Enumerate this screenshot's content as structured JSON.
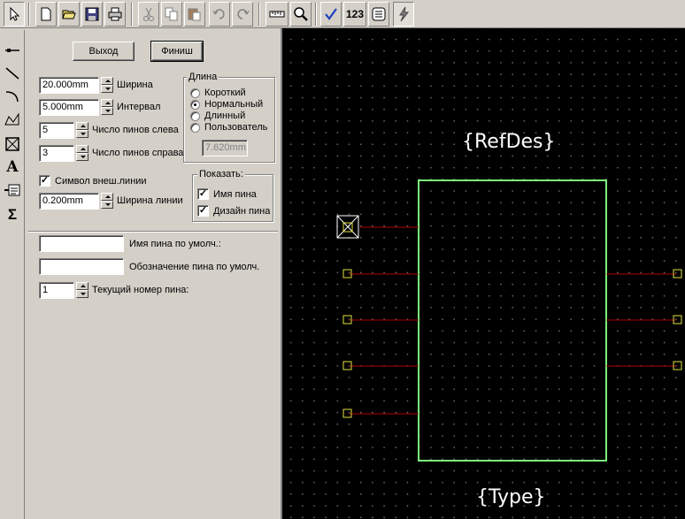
{
  "toolbar": {
    "icons": [
      "select-arrow-icon",
      "new-file-icon",
      "open-folder-icon",
      "save-icon",
      "print-icon",
      "cut-icon",
      "copy-icon",
      "paste-icon",
      "undo-icon",
      "redo-icon",
      "ruler-icon",
      "zoom-icon",
      "checkmark-icon",
      "number-icon",
      "properties-icon",
      "lightning-icon"
    ],
    "number_label": "123"
  },
  "left_tools": {
    "icons": [
      "pin-tool-icon",
      "line-tool-icon",
      "arc-tool-icon",
      "polyline-tool-icon",
      "box-cross-tool-icon",
      "text-tool-icon",
      "attribute-tool-icon",
      "sigma-tool-icon"
    ],
    "text_tool_label": "A",
    "sigma_label": "Σ"
  },
  "buttons": {
    "exit": "Выход",
    "finish": "Финиш"
  },
  "params": {
    "width_value": "20.000mm",
    "width_label": "Ширина",
    "interval_value": "5.000mm",
    "interval_label": "Интервал",
    "pins_left_value": "5",
    "pins_left_label": "Число пинов слева",
    "pins_right_value": "3",
    "pins_right_label": "Число пинов справа",
    "outline_label": "Символ внеш.линии",
    "line_width_value": "0.200mm",
    "line_width_label": "Ширина линии"
  },
  "length_group": {
    "title": "Длина",
    "options": [
      "Короткий",
      "Нормальный",
      "Длинный",
      "Пользователь"
    ],
    "selected": "Нормальный",
    "custom_value": "7.620mm"
  },
  "show_group": {
    "title": "Показать:",
    "pin_name": "Имя пина",
    "pin_design": "Дизайн пина"
  },
  "defaults": {
    "pin_name_value": "",
    "pin_name_label": "Имя пина по умолч.:",
    "pin_des_value": "",
    "pin_des_label": "Обозначение пина по умолч.",
    "cur_pin_value": "1",
    "cur_pin_label": "Текущий номер пина:"
  },
  "canvas": {
    "refdes": "{RefDes}",
    "type": "{Type}",
    "body_color": "#7cf07c",
    "pin_line_color": "#b00000",
    "pin_marker_color": "#e0e040",
    "left_pin_count": 5,
    "right_pin_count": 3
  }
}
